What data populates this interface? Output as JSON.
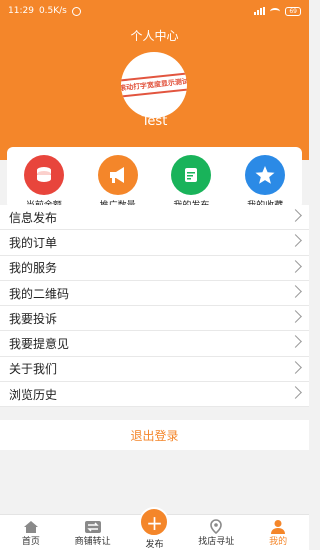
{
  "status_bar": {
    "time": "11:29",
    "speed": "0.5K/s",
    "battery": "69"
  },
  "header": {
    "title": "个人中心",
    "username": "Test",
    "avatar_stamp": "滚动打字宽度显示测试"
  },
  "stats": [
    {
      "label": "当前余额",
      "icon": "coins-icon",
      "color": "#e8453c"
    },
    {
      "label": "推广数量",
      "icon": "megaphone-icon",
      "color": "#f4862a"
    },
    {
      "label": "我的发布",
      "icon": "edit-document-icon",
      "color": "#19b35a"
    },
    {
      "label": "我的收藏",
      "icon": "star-icon",
      "color": "#2b8ae6"
    }
  ],
  "menu": [
    {
      "label": "信息发布"
    },
    {
      "label": "我的订单"
    },
    {
      "label": "我的服务"
    },
    {
      "label": "我的二维码"
    },
    {
      "label": "我要投诉"
    },
    {
      "label": "我要提意见"
    },
    {
      "label": "关于我们"
    },
    {
      "label": "浏览历史"
    }
  ],
  "logout_label": "退出登录",
  "tabbar": [
    {
      "label": "首页",
      "icon": "home-icon"
    },
    {
      "label": "商铺转让",
      "icon": "transfer-icon"
    },
    {
      "label": "发布",
      "icon": "plus-icon",
      "glyph": "+"
    },
    {
      "label": "找店寻址",
      "icon": "location-icon"
    },
    {
      "label": "我的",
      "icon": "person-icon",
      "active": true
    }
  ],
  "colors": {
    "accent": "#f4862a"
  }
}
